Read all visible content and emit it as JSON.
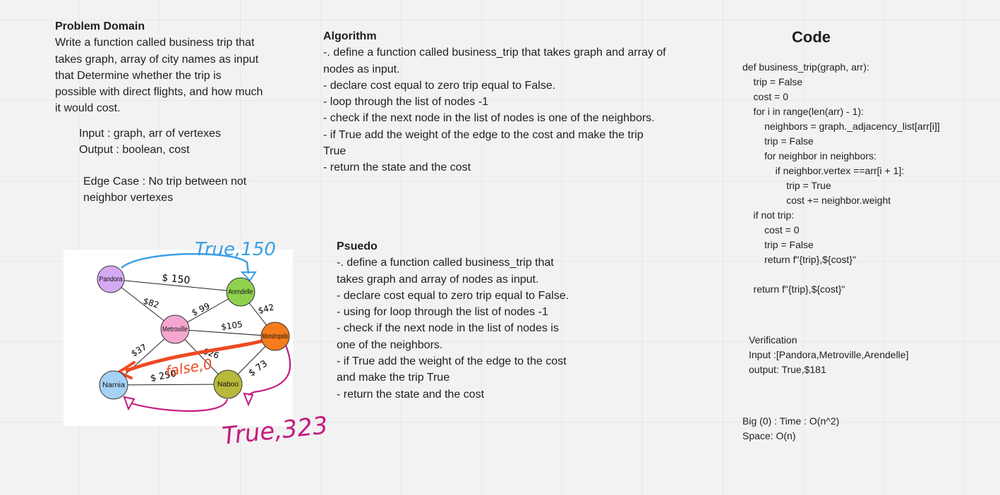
{
  "problem": {
    "title": "Problem Domain",
    "lines": [
      "Write a function called business trip that",
      "takes  graph, array of city names as input",
      "that Determine whether the trip is",
      "possible with  direct flights, and how much",
      "it would cost."
    ],
    "input": "Input : graph, arr of vertexes",
    "output": "Output : boolean, cost",
    "edge_case_lines": [
      "Edge Case : No trip between not",
      "neighbor vertexes"
    ]
  },
  "algorithm": {
    "title": "Algorithm",
    "lines": [
      "-. define a function called  business_trip that takes graph and array of",
      "nodes as input.",
      "- declare cost equal to zero trip equal to False.",
      "- loop through the list of nodes -1",
      "- check if the next node in the list of nodes is one of the neighbors.",
      "- if True add the weight of the edge to the cost and make the trip",
      "True",
      "- return the state and the cost"
    ]
  },
  "pseudo": {
    "title": "Psuedo",
    "lines": [
      "-. define a function called business_trip that",
      "takes graph and array of nodes as input.",
      "- declare cost equal to zero trip equal to False.",
      "- using for loop through the list of nodes -1",
      "- check if the next node in the list of nodes is",
      "one of the neighbors.",
      "- if True add the weight of the edge to the cost",
      "and make the trip True",
      "- return the state and the cost"
    ]
  },
  "code": {
    "title": "Code",
    "lines": [
      "def business_trip(graph, arr):",
      "    trip = False",
      "    cost = 0",
      "    for i in range(len(arr) - 1):",
      "        neighbors = graph._adjacency_list[arr[i]]",
      "        trip = False",
      "        for neighbor in neighbors:",
      "            if neighbor.vertex ==arr[i + 1]:",
      "                trip = True",
      "                cost += neighbor.weight",
      "    if not trip:",
      "        cost = 0",
      "        trip = False",
      "        return f\"{trip},${cost}\"",
      "",
      "    return f\"{trip},${cost}\""
    ]
  },
  "verification": {
    "title": "Verification",
    "input": "Input :[Pandora,Metroville,Arendelle]",
    "output": "output: True,$181"
  },
  "bigo": {
    "time": "Big (0) : Time : O(n^2)",
    "space": "Space: O(n)"
  },
  "graph": {
    "nodes": {
      "pandora": "Pandora",
      "arendelle": "Arendelle",
      "metroville": "Metroville",
      "monstropolis": "Monstropolis",
      "narnia": "Narnia",
      "naboo": "Naboo"
    },
    "edge_labels": {
      "pandora_arendelle": "$ 150",
      "pandora_metroville": "$82",
      "metroville_arendelle": "$ 99",
      "arendelle_monstropolis": "$42",
      "metroville_monstropolis": "$105",
      "metroville_narnia": "$37",
      "metroville_naboo": "$26",
      "narnia_naboo": "$ 250",
      "naboo_monstropolis": "$ 73"
    },
    "annotations": {
      "top": "True,150",
      "middle": "false,0",
      "bottom": "True,323"
    },
    "colors": {
      "pandora": "#d6aaf2",
      "arendelle": "#8fd14f",
      "metroville": "#f4a6cf",
      "monstropolis": "#f57c1c",
      "narnia": "#a7d2f5",
      "naboo": "#b8b83a",
      "blue_arrow": "#3a9ee6",
      "red_arrow": "#ee4a23",
      "magenta_arrow": "#c41a7e"
    }
  }
}
